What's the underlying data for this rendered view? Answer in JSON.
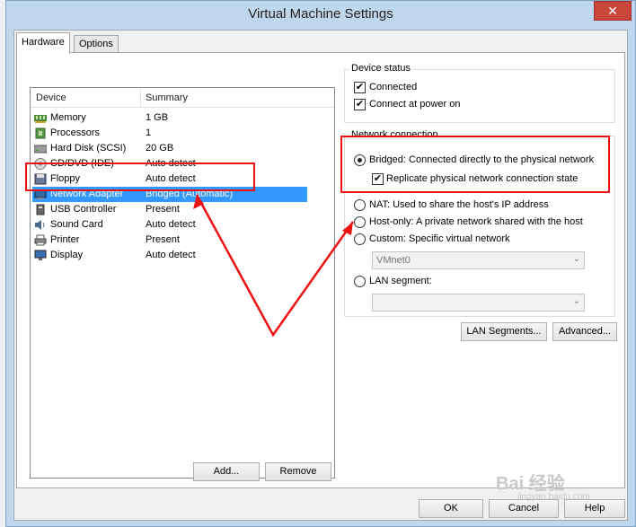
{
  "window": {
    "title": "Virtual Machine Settings",
    "close_glyph": "✕"
  },
  "tabs": [
    {
      "label": "Hardware"
    },
    {
      "label": "Options"
    }
  ],
  "device_list": {
    "columns": {
      "device": "Device",
      "summary": "Summary"
    },
    "rows": [
      {
        "name": "Memory",
        "summary": "1 GB",
        "icon": "memory-icon"
      },
      {
        "name": "Processors",
        "summary": "1",
        "icon": "processor-icon"
      },
      {
        "name": "Hard Disk (SCSI)",
        "summary": "20 GB",
        "icon": "hard-disk-icon"
      },
      {
        "name": "CD/DVD (IDE)",
        "summary": "Auto detect",
        "icon": "cd-dvd-icon"
      },
      {
        "name": "Floppy",
        "summary": "Auto detect",
        "icon": "floppy-icon"
      },
      {
        "name": "Network Adapter",
        "summary": "Bridged (Automatic)",
        "icon": "network-adapter-icon"
      },
      {
        "name": "USB Controller",
        "summary": "Present",
        "icon": "usb-icon"
      },
      {
        "name": "Sound Card",
        "summary": "Auto detect",
        "icon": "sound-card-icon"
      },
      {
        "name": "Printer",
        "summary": "Present",
        "icon": "printer-icon"
      },
      {
        "name": "Display",
        "summary": "Auto detect",
        "icon": "display-icon"
      }
    ],
    "selected": "Network Adapter"
  },
  "buttons": {
    "add": "Add...",
    "remove": "Remove",
    "lan_segments": "LAN Segments...",
    "advanced": "Advanced...",
    "ok": "OK",
    "cancel": "Cancel",
    "help": "Help"
  },
  "device_status": {
    "label": "Device status",
    "connected": {
      "label": "Connected",
      "checked": true
    },
    "connect_at_power_on": {
      "label": "Connect at power on",
      "checked": true
    }
  },
  "network_connection": {
    "label": "Network connection",
    "bridged": {
      "label": "Bridged: Connected directly to the physical network",
      "selected": true
    },
    "replicate": {
      "label": "Replicate physical network connection state",
      "checked": true
    },
    "nat": {
      "label": "NAT: Used to share the host's IP address",
      "selected": false
    },
    "host_only": {
      "label": "Host-only: A private network shared with the host",
      "selected": false
    },
    "custom": {
      "label": "Custom: Specific virtual network",
      "selected": false
    },
    "vmnet_value": "VMnet0",
    "lan_segment": {
      "label": "LAN segment:",
      "selected": false
    },
    "lan_segment_value": ""
  },
  "watermark": {
    "text": "Bai  经验",
    "sub": "jingyan.baidu.com"
  },
  "colors": {
    "callout": "#ee1111",
    "selection": "#3399ff",
    "titlebar": "#bfd7ec",
    "close": "#c7483a"
  }
}
